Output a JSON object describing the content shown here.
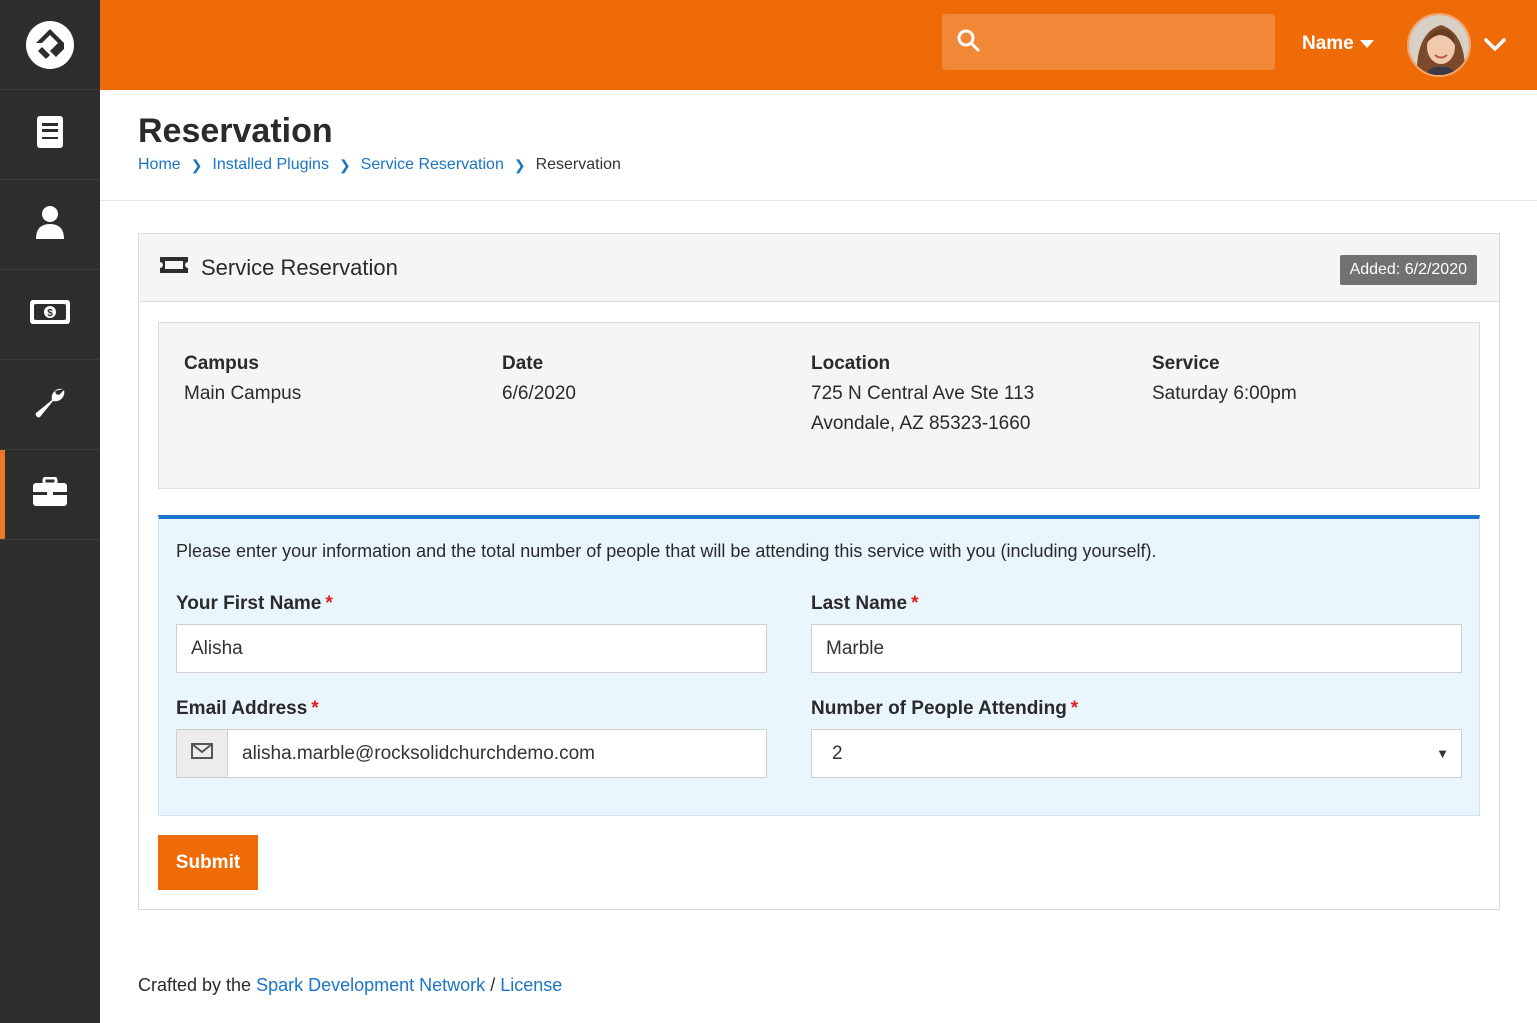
{
  "sidebar": {
    "logo": "rock-logo",
    "items": [
      {
        "icon": "book-icon"
      },
      {
        "icon": "person-icon"
      },
      {
        "icon": "money-icon"
      },
      {
        "icon": "wrench-icon"
      },
      {
        "icon": "briefcase-icon",
        "active": true
      }
    ]
  },
  "header": {
    "search_placeholder": "",
    "user_name": "Name"
  },
  "page": {
    "title": "Reservation",
    "breadcrumb": [
      "Home",
      "Installed Plugins",
      "Service Reservation",
      "Reservation"
    ]
  },
  "panel": {
    "title": "Service Reservation",
    "badge": "Added: 6/2/2020",
    "info": {
      "campus_label": "Campus",
      "campus_value": "Main Campus",
      "date_label": "Date",
      "date_value": "6/6/2020",
      "location_label": "Location",
      "location_line1": "725 N Central Ave Ste 113",
      "location_line2": "Avondale, AZ 85323-1660",
      "service_label": "Service",
      "service_value": "Saturday 6:00pm"
    },
    "form": {
      "intro": "Please enter your information and the total number of people that will be attending this service with you (including yourself).",
      "first_name_label": "Your First Name",
      "first_name_value": "Alisha",
      "last_name_label": "Last Name",
      "last_name_value": "Marble",
      "email_label": "Email Address",
      "email_value": "alisha.marble@rocksolidchurchdemo.com",
      "people_label": "Number of People Attending",
      "people_value": "2",
      "required_mark": "*"
    },
    "submit_label": "Submit"
  },
  "footer": {
    "prefix": "Crafted by the",
    "link1": "Spark Development Network",
    "sep": "/",
    "link2": "License"
  },
  "colors": {
    "brand_orange": "#ee6b08",
    "sidebar_bg": "#2d2d2d",
    "link_blue": "#1b74c5",
    "form_bg": "#eaf6fe",
    "required_red": "#e21d1d"
  }
}
